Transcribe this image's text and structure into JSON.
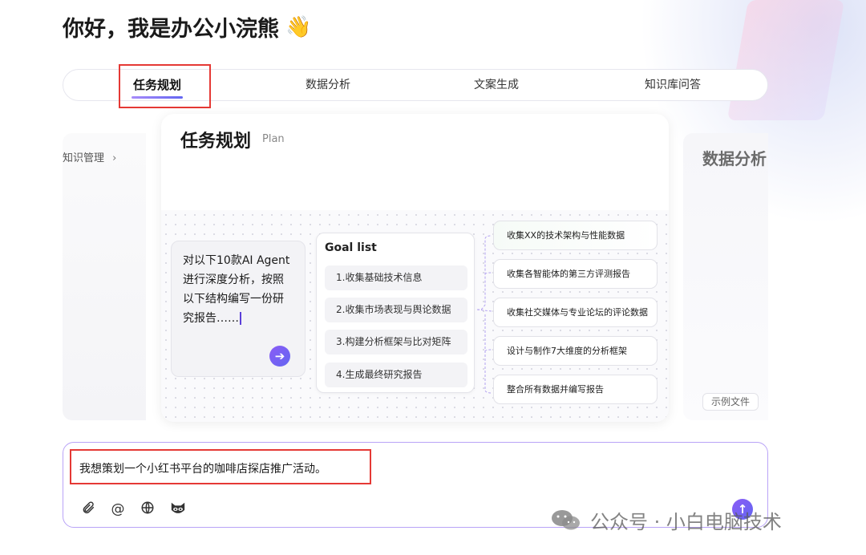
{
  "greeting": {
    "text": "你好，我是办公小浣熊",
    "emoji": "👋"
  },
  "tabs": [
    {
      "label": "任务规划",
      "active": true
    },
    {
      "label": "数据分析",
      "active": false
    },
    {
      "label": "文案生成",
      "active": false
    },
    {
      "label": "知识库问答",
      "active": false
    }
  ],
  "left_panel": {
    "label": "知识管理",
    "chevron": "›"
  },
  "right_panel": {
    "title": "数据分析",
    "sample_file": "示例文件"
  },
  "card": {
    "title": "任务规划",
    "title_en": "Plan",
    "prompt_text": "对以下10款AI Agent进行深度分析，按照以下结构编写一份研究报告……",
    "goal_list_title": "Goal list",
    "goals": [
      "1.收集基础技术信息",
      "2.收集市场表现与舆论数据",
      "3.构建分析框架与比对矩阵",
      "4.生成最终研究报告"
    ],
    "results": [
      "收集XX的技术架构与性能数据",
      "收集各智能体的第三方评测报告",
      "收集社交媒体与专业论坛的评论数据",
      "设计与制作7大维度的分析框架",
      "整合所有数据并编写报告"
    ]
  },
  "input": {
    "value": "我想策划一个小红书平台的咖啡店探店推广活动。",
    "tools": [
      "paperclip-icon",
      "at-icon",
      "globe-icon",
      "raccoon-icon"
    ]
  },
  "watermark": {
    "text": "公众号 · 小白电脑技术"
  },
  "colors": {
    "accent": "#6366f1",
    "accent_light": "#a78bfa",
    "highlight_box": "#e53935"
  }
}
